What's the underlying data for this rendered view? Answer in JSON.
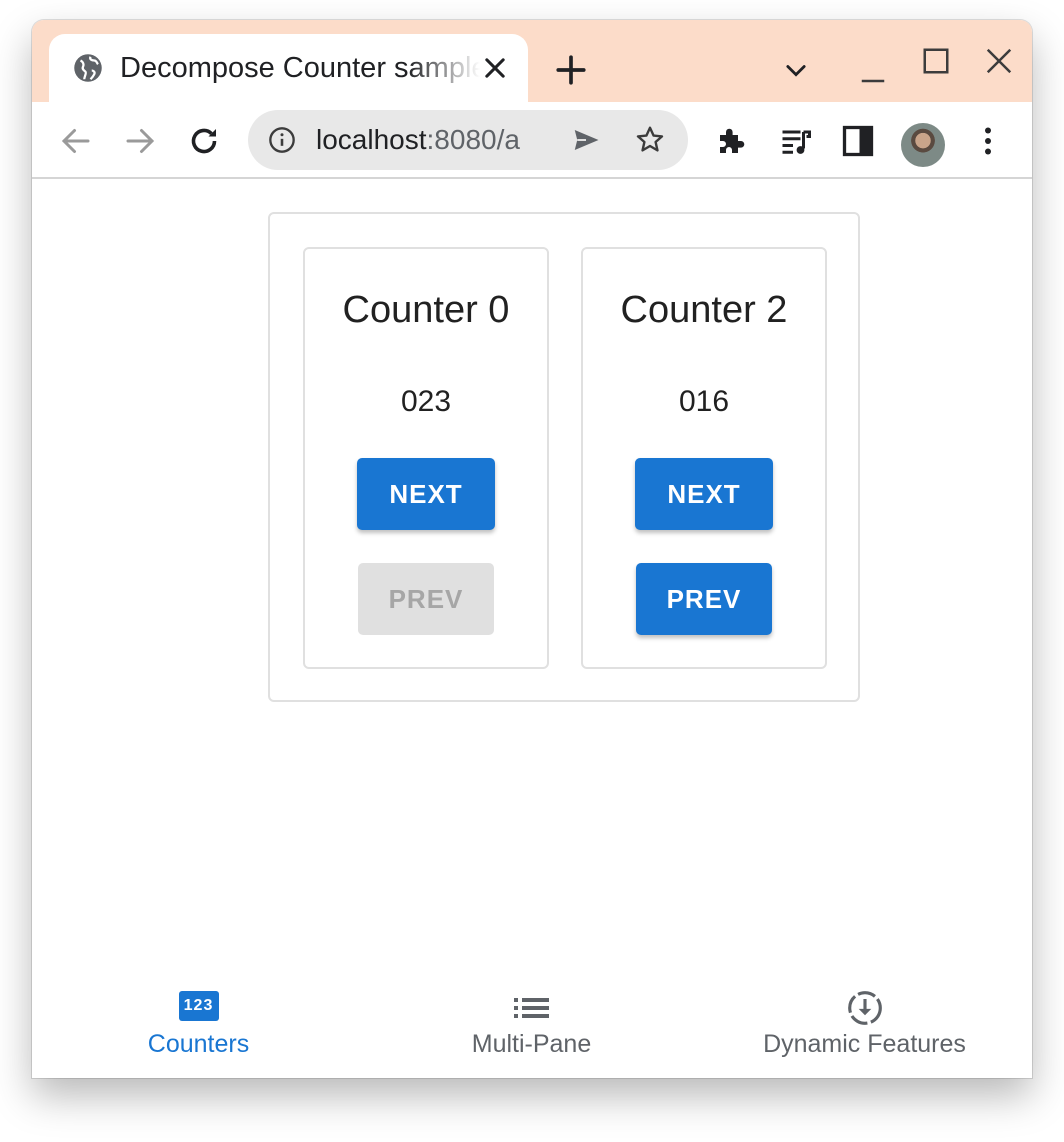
{
  "browser": {
    "tab_title": "Decompose Counter sample",
    "url_host": "localhost",
    "url_rest": ":8080/a"
  },
  "counters": [
    {
      "title": "Counter 0",
      "value": "023",
      "next_label": "NEXT",
      "prev_label": "PREV",
      "prev_enabled": false
    },
    {
      "title": "Counter 2",
      "value": "016",
      "next_label": "NEXT",
      "prev_label": "PREV",
      "prev_enabled": true
    }
  ],
  "bottom_nav": [
    {
      "label": "Counters",
      "icon": "numbers-123-icon",
      "active": true,
      "icon_text": "123"
    },
    {
      "label": "Multi-Pane",
      "icon": "list-icon",
      "active": false
    },
    {
      "label": "Dynamic Features",
      "icon": "download-circle-icon",
      "active": false
    }
  ],
  "colors": {
    "accent": "#1976d2",
    "tabstrip": "#fcdcc9",
    "disabled_button": "#e0e0e0"
  }
}
